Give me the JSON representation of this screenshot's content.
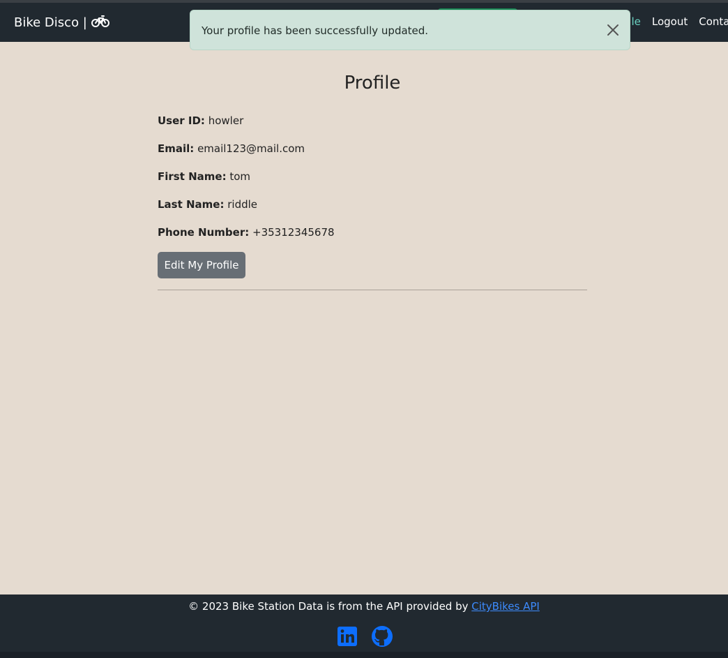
{
  "navbar": {
    "brand": "Bike Disco |",
    "brand_icon": "bicycle-icon",
    "links": [
      {
        "label": "file",
        "active": true
      },
      {
        "label": "Logout",
        "active": false
      },
      {
        "label": "Conta",
        "active": false
      }
    ]
  },
  "toast": {
    "message": "Your profile has been successfully updated.",
    "close_icon": "close-icon"
  },
  "profile": {
    "title": "Profile",
    "fields": [
      {
        "label": "User ID:",
        "value": "howler"
      },
      {
        "label": "Email:",
        "value": "email123@mail.com"
      },
      {
        "label": "First Name:",
        "value": "tom"
      },
      {
        "label": "Last Name:",
        "value": "riddle"
      },
      {
        "label": "Phone Number:",
        "value": "+35312345678"
      }
    ],
    "edit_button": "Edit My Profile"
  },
  "footer": {
    "text": "© 2023 Bike Station Data is from the API provided by",
    "link": "CityBikes API",
    "icons": [
      "linkedin-icon",
      "github-icon"
    ]
  },
  "colors": {
    "navbar_bg": "#212930",
    "page_bg": "#e5dbd0",
    "toast_bg": "#cfe3da",
    "button_bg": "#676e75",
    "link_blue": "#3d8bfd",
    "active_link": "#6ad3c2"
  }
}
